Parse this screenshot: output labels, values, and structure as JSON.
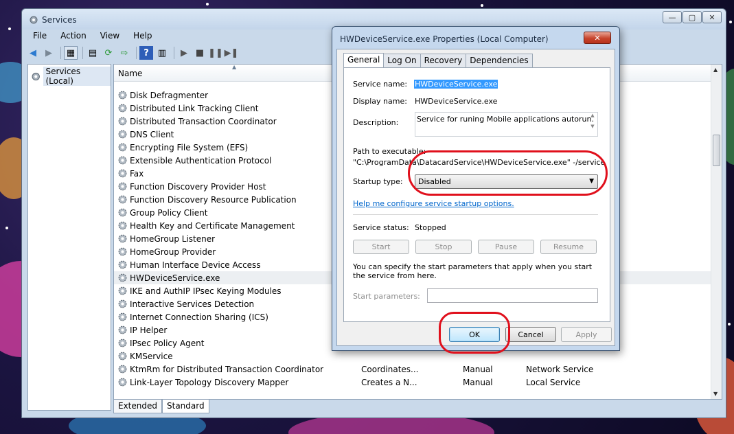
{
  "window": {
    "title": "Services",
    "menu": [
      "File",
      "Action",
      "View",
      "Help"
    ],
    "caption": {
      "minimize": "—",
      "maximize": "▢",
      "close": "✕"
    }
  },
  "left_pane": {
    "tree_root": "Services (Local)"
  },
  "list": {
    "column_name": "Name",
    "rows": [
      {
        "name": "Disk Defragmenter",
        "desc": "",
        "startup": "",
        "logon": ""
      },
      {
        "name": "Distributed Link Tracking Client",
        "desc": "",
        "startup": "",
        "logon": ""
      },
      {
        "name": "Distributed Transaction Coordinator",
        "desc": "",
        "startup": "",
        "logon": ""
      },
      {
        "name": "DNS Client",
        "desc": "",
        "startup": "",
        "logon": ""
      },
      {
        "name": "Encrypting File System (EFS)",
        "desc": "",
        "startup": "",
        "logon": ""
      },
      {
        "name": "Extensible Authentication Protocol",
        "desc": "",
        "startup": "",
        "logon": ""
      },
      {
        "name": "Fax",
        "desc": "",
        "startup": "",
        "logon": ""
      },
      {
        "name": "Function Discovery Provider Host",
        "desc": "",
        "startup": "",
        "logon": ""
      },
      {
        "name": "Function Discovery Resource Publication",
        "desc": "",
        "startup": "",
        "logon": ""
      },
      {
        "name": "Group Policy Client",
        "desc": "",
        "startup": "",
        "logon": ""
      },
      {
        "name": "Health Key and Certificate Management",
        "desc": "",
        "startup": "",
        "logon": ""
      },
      {
        "name": "HomeGroup Listener",
        "desc": "",
        "startup": "",
        "logon": ""
      },
      {
        "name": "HomeGroup Provider",
        "desc": "",
        "startup": "",
        "logon": ""
      },
      {
        "name": "Human Interface Device Access",
        "desc": "",
        "startup": "",
        "logon": ""
      },
      {
        "name": "HWDeviceService.exe",
        "desc": "",
        "startup": "",
        "logon": "",
        "selected": true
      },
      {
        "name": "IKE and AuthIP IPsec Keying Modules",
        "desc": "",
        "startup": "",
        "logon": ""
      },
      {
        "name": "Interactive Services Detection",
        "desc": "",
        "startup": "",
        "logon": ""
      },
      {
        "name": "Internet Connection Sharing (ICS)",
        "desc": "",
        "startup": "",
        "logon": ""
      },
      {
        "name": "IP Helper",
        "desc": "",
        "startup": "",
        "logon": ""
      },
      {
        "name": "IPsec Policy Agent",
        "desc": "",
        "startup": "",
        "logon": ""
      },
      {
        "name": "KMService",
        "desc": "",
        "startup": "",
        "logon": ""
      },
      {
        "name": "KtmRm for Distributed Transaction Coordinator",
        "desc": "Coordinates...",
        "startup": "Manual",
        "logon": "Network Service"
      },
      {
        "name": "Link-Layer Topology Discovery Mapper",
        "desc": "Creates a N...",
        "startup": "Manual",
        "logon": "Local Service"
      }
    ]
  },
  "bottom_tabs": [
    "Extended",
    "Standard"
  ],
  "dialog": {
    "title": "HWDeviceService.exe Properties (Local Computer)",
    "close": "✕",
    "tabs": [
      "General",
      "Log On",
      "Recovery",
      "Dependencies"
    ],
    "service_name_label": "Service name:",
    "service_name": "HWDeviceService.exe",
    "display_name_label": "Display name:",
    "display_name": "HWDeviceService.exe",
    "description_label": "Description:",
    "description": "Service for runing Mobile applications autorun.",
    "path_label": "Path to executable:",
    "path": "\"C:\\ProgramData\\DatacardService\\HWDeviceService.exe\" -/service",
    "startup_type_label": "Startup type:",
    "startup_type": "Disabled",
    "help_link": "Help me configure service startup options.",
    "status_label": "Service status:",
    "status": "Stopped",
    "control_buttons": [
      "Start",
      "Stop",
      "Pause",
      "Resume"
    ],
    "start_params_hint": "You can specify the start parameters that apply when you start the service from here.",
    "start_params_label": "Start parameters:",
    "ok": "OK",
    "cancel": "Cancel",
    "apply": "Apply"
  },
  "colors": {
    "annotation": "#e0101c",
    "selection": "#3399ff",
    "link": "#0066cc"
  }
}
